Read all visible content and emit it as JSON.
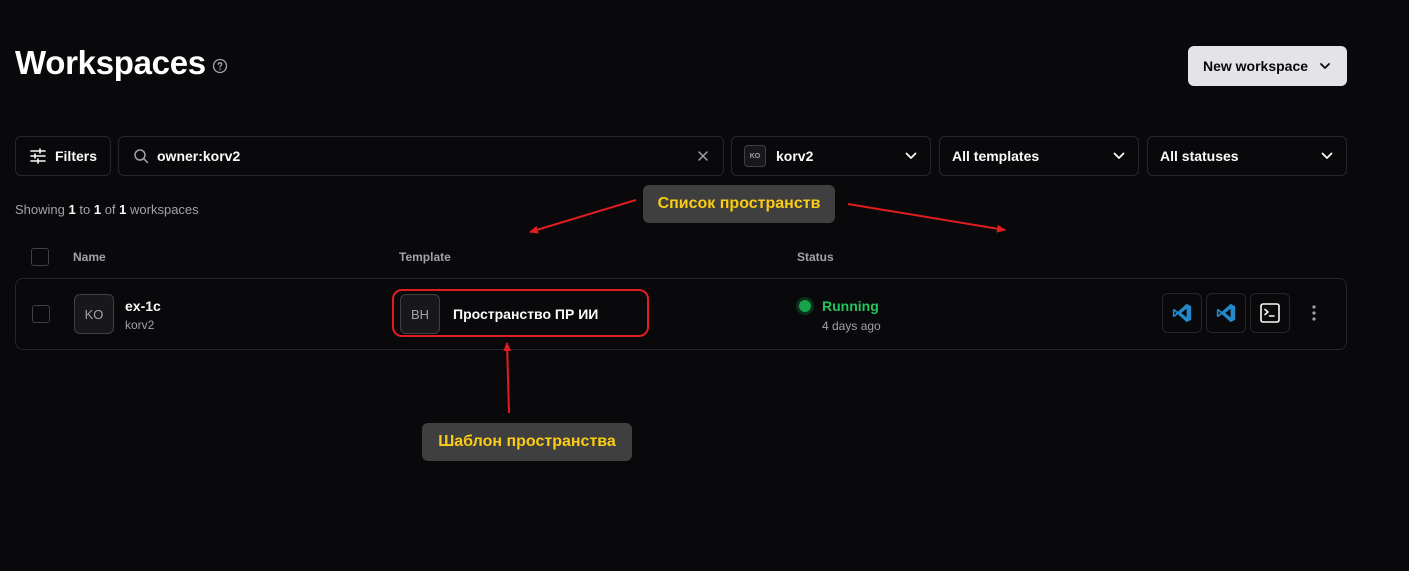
{
  "header": {
    "title": "Workspaces",
    "new_workspace_label": "New workspace"
  },
  "filters": {
    "filters_label": "Filters",
    "search_value": "owner:korv2",
    "owner_avatar": "KO",
    "owner_value": "korv2",
    "templates_value": "All templates",
    "statuses_value": "All statuses"
  },
  "summary": {
    "prefix": "Showing",
    "from": "1",
    "to_word": "to",
    "to": "1",
    "of_word": "of",
    "total": "1",
    "suffix": "workspaces"
  },
  "table": {
    "columns": [
      "Name",
      "Template",
      "Status"
    ],
    "rows": [
      {
        "avatar": "KO",
        "name": "ex-1c",
        "owner": "korv2",
        "template_avatar": "BH",
        "template": "Пространство ПР ИИ",
        "status": "Running",
        "status_time": "4 days ago"
      }
    ]
  },
  "annotations": {
    "list_label": "Список пространств",
    "template_label": "Шаблон пространства"
  },
  "colors": {
    "background": "#09090b",
    "running": "#22c55e",
    "annotation_text": "#facc15",
    "highlight": "#e11d20",
    "vscode": "#2489ca"
  },
  "icons": [
    "help-icon",
    "filters-icon",
    "search-icon",
    "clear-icon",
    "chevron-down-icon",
    "vscode-icon",
    "vscode-insiders-icon",
    "terminal-icon",
    "more-vertical-icon"
  ]
}
